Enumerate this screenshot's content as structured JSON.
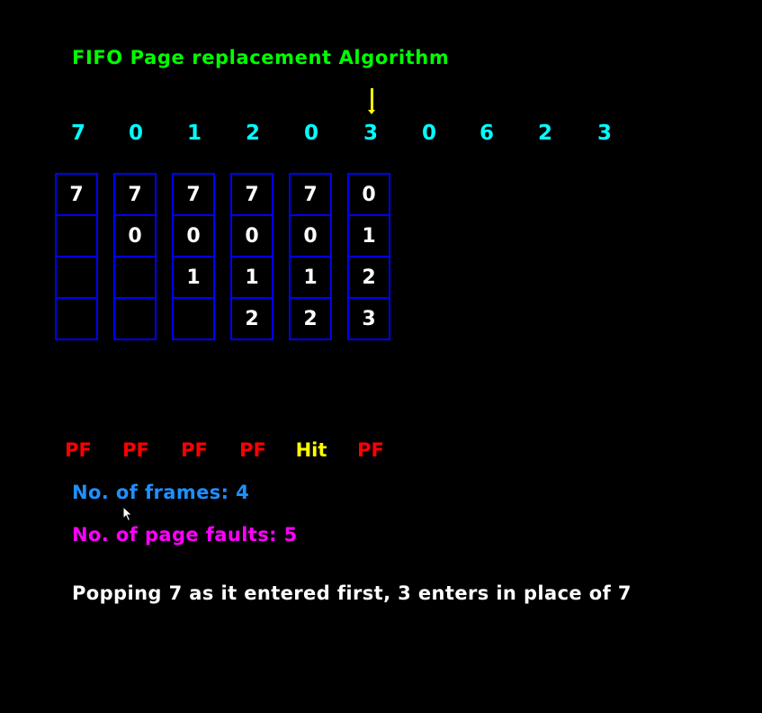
{
  "title": "FIFO Page replacement Algorithm",
  "reference_string": [
    "7",
    "0",
    "1",
    "2",
    "0",
    "3",
    "0",
    "6",
    "2",
    "3"
  ],
  "current_step": 6,
  "frames": [
    [
      "7",
      "",
      "",
      ""
    ],
    [
      "7",
      "0",
      "",
      ""
    ],
    [
      "7",
      "0",
      "1",
      ""
    ],
    [
      "7",
      "0",
      "1",
      "2"
    ],
    [
      "7",
      "0",
      "1",
      "2"
    ],
    [
      "0",
      "1",
      "2",
      "3"
    ]
  ],
  "statuses": [
    {
      "label": "PF",
      "color": "#ff0000"
    },
    {
      "label": "PF",
      "color": "#ff0000"
    },
    {
      "label": "PF",
      "color": "#ff0000"
    },
    {
      "label": "PF",
      "color": "#ff0000"
    },
    {
      "label": "Hit",
      "color": "#ffff00"
    },
    {
      "label": "PF",
      "color": "#ff0000"
    }
  ],
  "frames_text": "No. of frames: 4",
  "faults_text": "No. of page faults: 5",
  "message": "Popping 7 as it entered first, 3 enters in place of 7",
  "colors": {
    "background": "#000000",
    "title": "#00ff00",
    "reference": "#00ffff",
    "pointer": "#ffff00",
    "frame_border": "#0000ff",
    "frame_text": "#ffffff",
    "frames_info": "#1e90ff",
    "faults_info": "#ff00ff",
    "message": "#ffffff"
  }
}
